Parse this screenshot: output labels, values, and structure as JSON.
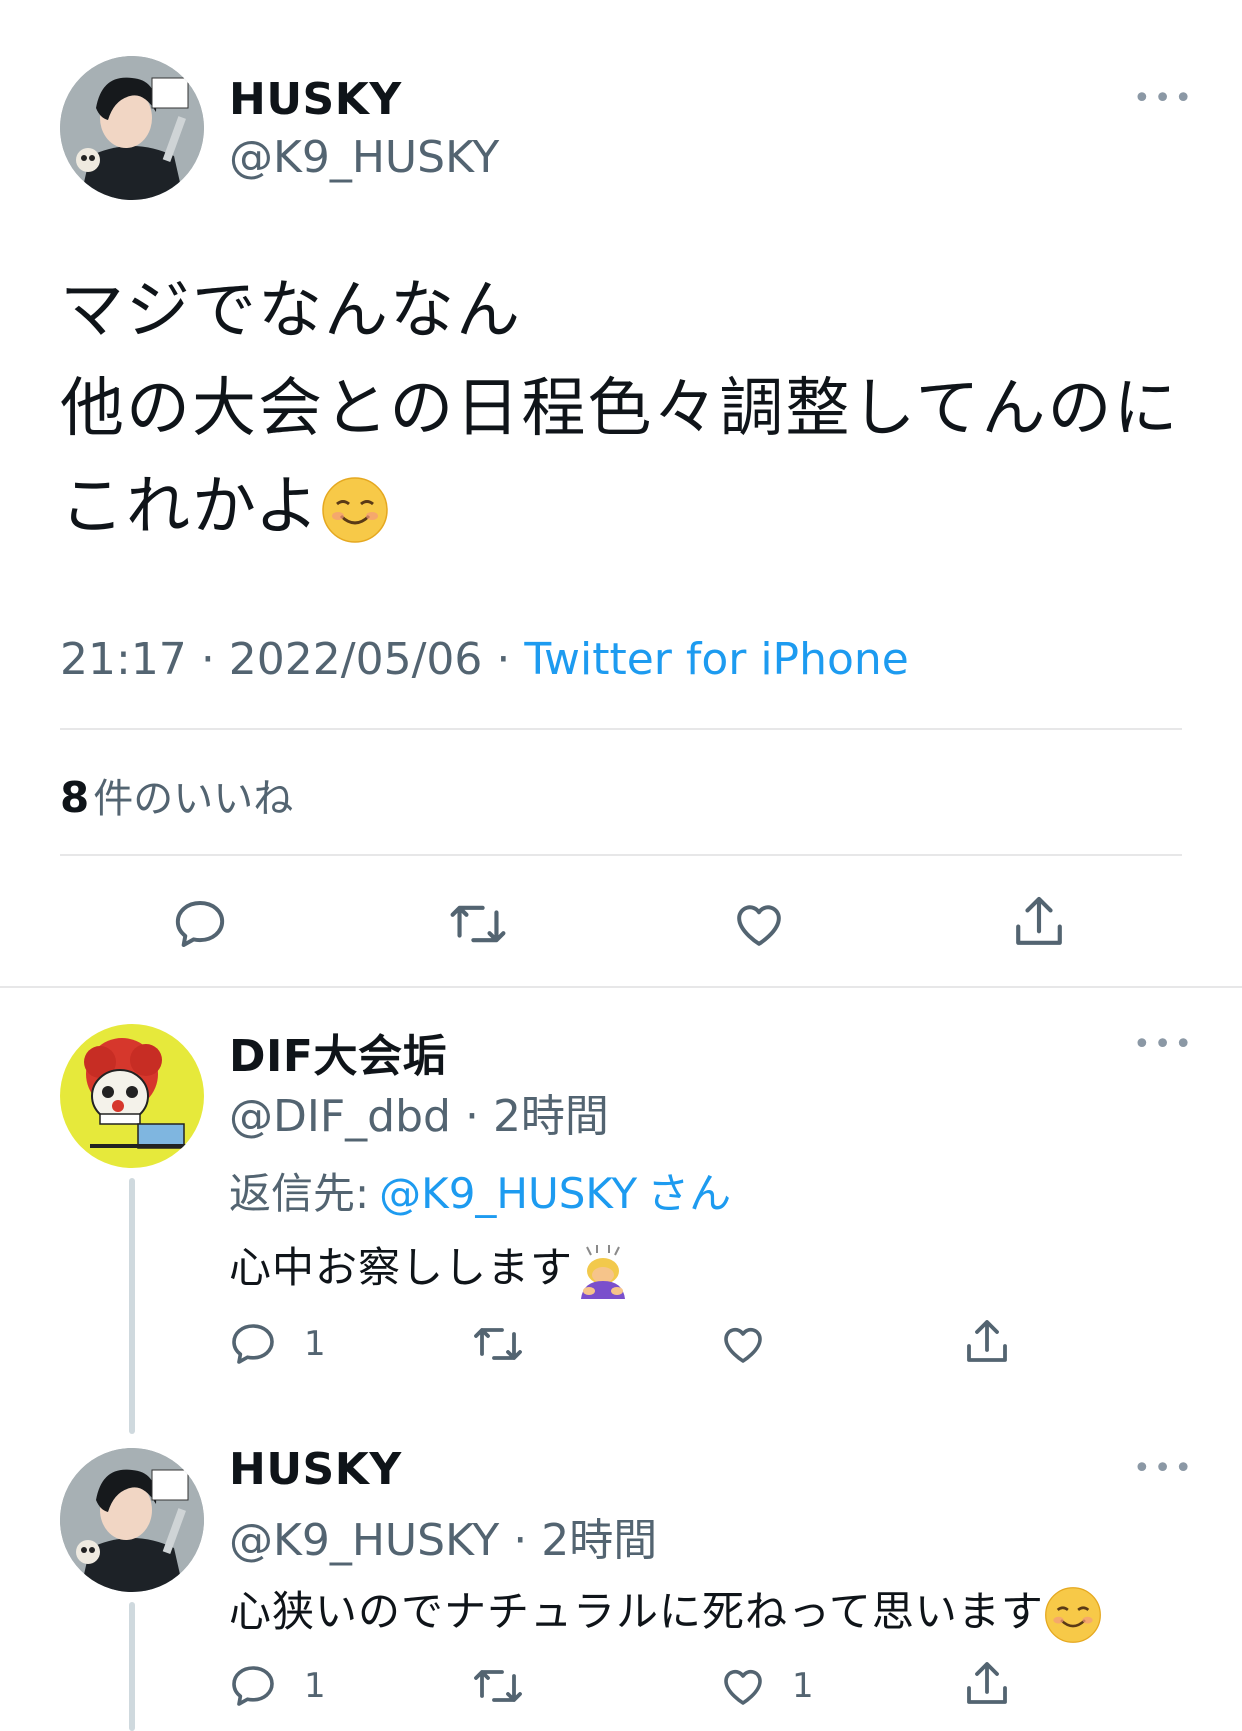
{
  "main_tweet": {
    "name": "HUSKY",
    "handle": "@K9_HUSKY",
    "more": "•••",
    "text_line1": "マジでなんなん",
    "text_line2": "他の大会との日程色々調整してんのに",
    "text_line3": "これかよ",
    "emoji": "smiling-face-icon",
    "time": "21:17",
    "date": "2022/05/06",
    "source": "Twitter for iPhone",
    "likes_count": "8",
    "likes_label": "件のいいね"
  },
  "reply1": {
    "name": "DIF大会垢",
    "handle": "@DIF_dbd",
    "time": "2時間",
    "reply_to_label": "返信先:",
    "reply_to_handle": "@K9_HUSKY",
    "reply_to_suffix": "さん",
    "text": "心中お察しします",
    "reply_count": "1",
    "like_count": ""
  },
  "reply2": {
    "name": "HUSKY",
    "handle": "@K9_HUSKY",
    "time": "2時間",
    "text": "心狭いのでナチュラルに死ねって思います",
    "reply_count": "1",
    "like_count": "1"
  },
  "colors": {
    "accent": "#1d9bf0",
    "text": "#0f1419",
    "muted": "#536471",
    "divider": "#e7e7e8"
  }
}
